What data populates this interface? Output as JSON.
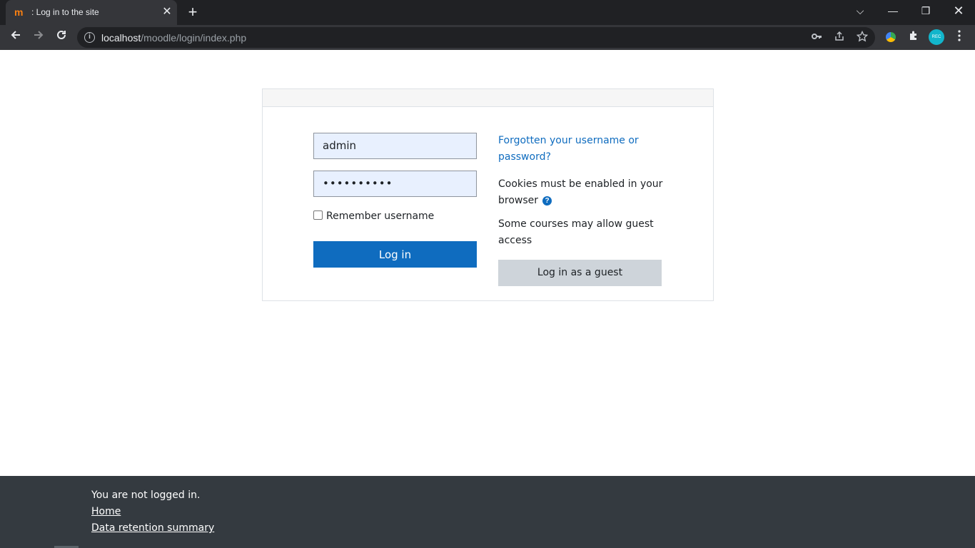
{
  "browser": {
    "tab_title": ": Log in to the site",
    "tab_close": "✕",
    "new_tab": "+",
    "url_host": "localhost",
    "url_path": "/moodle/login/index.php",
    "window_dropdown": "⌵",
    "window_min": "—",
    "window_max": "❐",
    "window_close": "✕",
    "avatar_text": "REC"
  },
  "login": {
    "username_value": "admin",
    "password_value": "••••••••••",
    "remember_label": "Remember username",
    "login_button": "Log in",
    "forgot_link": "Forgotten your username or password?",
    "cookies_text": "Cookies must be enabled in your browser",
    "help_icon": "?",
    "guest_text": "Some courses may allow guest access",
    "guest_button": "Log in as a guest"
  },
  "footer": {
    "status": "You are not logged in.",
    "home_link": "Home",
    "retention_link": "Data retention summary"
  },
  "colors": {
    "primary": "#0f6cbf",
    "input_bg": "#e8f0fe",
    "footer_bg": "#343a40",
    "guest_btn_bg": "#ced4da"
  }
}
